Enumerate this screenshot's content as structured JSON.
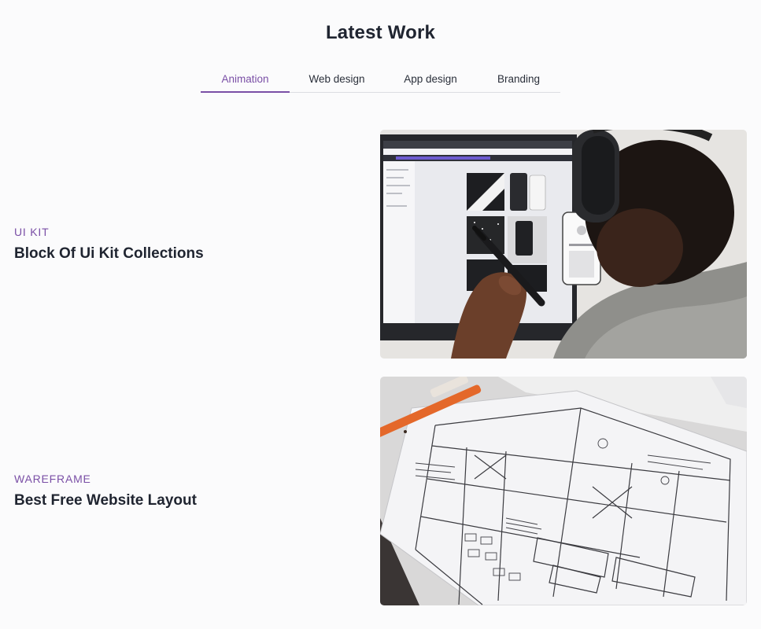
{
  "section": {
    "title": "Latest Work"
  },
  "tabs": [
    {
      "label": "Animation",
      "active": true
    },
    {
      "label": "Web design",
      "active": false
    },
    {
      "label": "App design",
      "active": false
    },
    {
      "label": "Branding",
      "active": false
    }
  ],
  "works": [
    {
      "category": "UI KIT",
      "title": "Block Of Ui Kit Collections",
      "image_icon": "person-with-headphones-at-monitor-photo"
    },
    {
      "category": "WAREFRAME",
      "title": "Best Free Website Layout",
      "image_icon": "wireframe-sketch-paper-photo"
    }
  ],
  "colors": {
    "accent": "#7a4fa6",
    "heading": "#1f2430",
    "background": "#fbfbfc",
    "divider": "#dcdde2"
  }
}
